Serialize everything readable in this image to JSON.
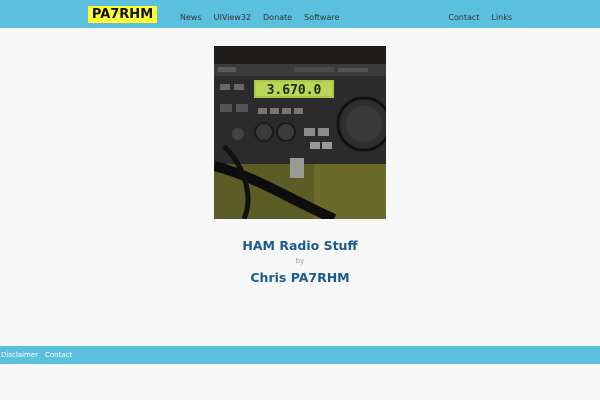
{
  "navbar": {
    "brand": "PA7RHM",
    "left_links": [
      "News",
      "UIView32",
      "Donate",
      "Software"
    ],
    "right_links": [
      "Contact",
      "Links"
    ]
  },
  "hero": {
    "photo_label": "radio-transceiver-photo",
    "radio_display": "3.670.0",
    "title": "HAM Radio Stuff",
    "by": "by",
    "author": "Chris PA7RHM"
  },
  "footer": {
    "links": [
      "Disclaimer",
      "Contact"
    ]
  },
  "colors": {
    "navbar_bg": "#5bc0de",
    "brand_bg": "#ffff33",
    "heading": "#1a5a8e",
    "page_bg": "#f7f7f7"
  }
}
